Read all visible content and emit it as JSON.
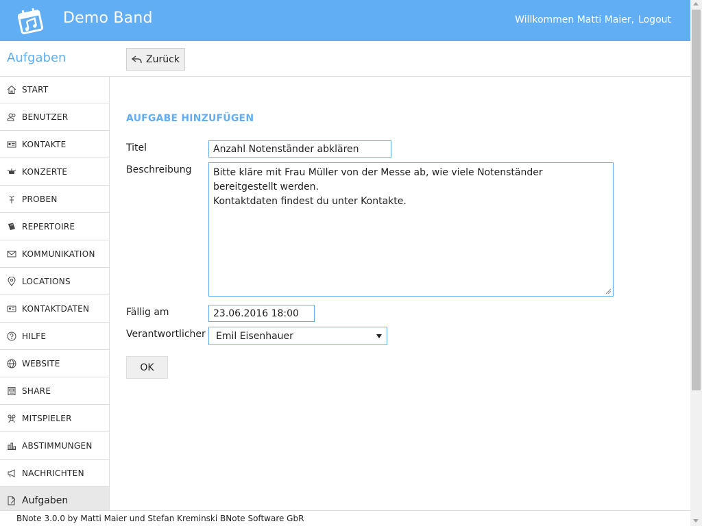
{
  "header": {
    "title": "Demo Band",
    "welcome": "Willkommen Matti Maier,",
    "logout": "Logout",
    "color": "#61aef5"
  },
  "module_title": "Aufgaben",
  "back_button": "Zurück",
  "sidebar": {
    "items": [
      {
        "label": "START",
        "icon": "home-icon"
      },
      {
        "label": "BENUTZER",
        "icon": "user-icon"
      },
      {
        "label": "KONTAKTE",
        "icon": "contact-card-icon"
      },
      {
        "label": "KONZERTE",
        "icon": "concert-icon"
      },
      {
        "label": "PROBEN",
        "icon": "rehearsal-icon"
      },
      {
        "label": "REPERTOIRE",
        "icon": "book-icon"
      },
      {
        "label": "KOMMUNIKATION",
        "icon": "mail-icon"
      },
      {
        "label": "LOCATIONS",
        "icon": "location-pin-icon"
      },
      {
        "label": "KONTAKTDATEN",
        "icon": "contact-data-icon"
      },
      {
        "label": "HILFE",
        "icon": "help-icon"
      },
      {
        "label": "WEBSITE",
        "icon": "globe-icon"
      },
      {
        "label": "SHARE",
        "icon": "share-icon"
      },
      {
        "label": "MITSPIELER",
        "icon": "group-icon"
      },
      {
        "label": "ABSTIMMUNGEN",
        "icon": "bar-chart-icon"
      },
      {
        "label": "NACHRICHTEN",
        "icon": "megaphone-icon"
      },
      {
        "label": "Aufgaben",
        "icon": "document-edit-icon",
        "active": true
      }
    ]
  },
  "form": {
    "heading": "AUFGABE HINZUFÜGEN",
    "title_label": "Titel",
    "title_value": "Anzahl Notenständer abklären",
    "description_label": "Beschreibung",
    "description_value": "Bitte kläre mit Frau Müller von der Messe ab, wie viele Notenständer bereitgestellt werden.\nKontaktdaten findest du unter Kontakte.",
    "due_label": "Fällig am",
    "due_value": "23.06.2016 18:00",
    "responsible_label": "Verantwortlicher",
    "responsible_value": "Emil Eisenhauer",
    "ok_button": "OK"
  },
  "footer": {
    "text": "BNote 3.0.0 by Matti Maier und Stefan Kreminski BNote Software GbR"
  }
}
